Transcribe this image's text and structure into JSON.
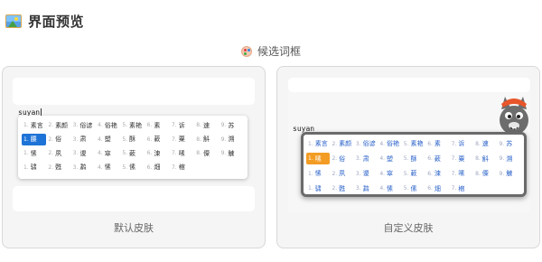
{
  "header": {
    "title": "界面预览",
    "icon": "picture-icon"
  },
  "subheader": {
    "title": "候选词框",
    "icon": "palette-icon"
  },
  "default_skin": {
    "label": "默认皮肤",
    "pinyin": "suyan",
    "accent_color": "#1e73d7",
    "rows": [
      [
        {
          "num": "1.",
          "text": "素言"
        },
        {
          "num": "2.",
          "text": "素颜"
        },
        {
          "num": "3.",
          "text": "俗谚"
        },
        {
          "num": "4.",
          "text": "俗艳"
        },
        {
          "num": "5.",
          "text": "素艳"
        },
        {
          "num": "6.",
          "text": "素"
        },
        {
          "num": "7.",
          "text": "诉"
        },
        {
          "num": "8.",
          "text": "速"
        },
        {
          "num": "9.",
          "text": "苏"
        }
      ],
      [
        {
          "num": "1.",
          "text": "腰",
          "selected": true
        },
        {
          "num": "2.",
          "text": "俗"
        },
        {
          "num": "3.",
          "text": "肃"
        },
        {
          "num": "4.",
          "text": "塑"
        },
        {
          "num": "5.",
          "text": "酥"
        },
        {
          "num": "6.",
          "text": "蔌"
        },
        {
          "num": "7.",
          "text": "粟"
        },
        {
          "num": "8.",
          "text": "斛"
        },
        {
          "num": "9.",
          "text": "溯"
        }
      ],
      [
        {
          "num": "1.",
          "text": "愫"
        },
        {
          "num": "2.",
          "text": "夙"
        },
        {
          "num": "3.",
          "text": "谡"
        },
        {
          "num": "4.",
          "text": "窣"
        },
        {
          "num": "5.",
          "text": "蔌"
        },
        {
          "num": "6.",
          "text": "涑"
        },
        {
          "num": "7.",
          "text": "嗉"
        },
        {
          "num": "8.",
          "text": "僳"
        },
        {
          "num": "9.",
          "text": "觫"
        }
      ],
      [
        {
          "num": "1.",
          "text": "骕"
        },
        {
          "num": "2.",
          "text": "甦"
        },
        {
          "num": "3.",
          "text": "鹔"
        },
        {
          "num": "4.",
          "text": "愫"
        },
        {
          "num": "5.",
          "text": "傃"
        },
        {
          "num": "6.",
          "text": "畑"
        },
        {
          "num": "7.",
          "text": "樎"
        }
      ]
    ]
  },
  "custom_skin": {
    "label": "自定义皮肤",
    "pinyin": "suyan",
    "accent_color": "#f39c24",
    "mascot": "gray-cat-mascot",
    "rows": [
      [
        {
          "num": "1.",
          "text": "素言"
        },
        {
          "num": "2.",
          "text": "素颜"
        },
        {
          "num": "3.",
          "text": "俗谚"
        },
        {
          "num": "4.",
          "text": "俗艳"
        },
        {
          "num": "5.",
          "text": "素艳"
        },
        {
          "num": "6.",
          "text": "素"
        },
        {
          "num": "7.",
          "text": "诉"
        },
        {
          "num": "8.",
          "text": "速"
        },
        {
          "num": "9.",
          "text": "苏"
        }
      ],
      [
        {
          "num": "1.",
          "text": "嗉",
          "selected": true
        },
        {
          "num": "2.",
          "text": "俗"
        },
        {
          "num": "3.",
          "text": "肃"
        },
        {
          "num": "4.",
          "text": "塑"
        },
        {
          "num": "5.",
          "text": "酥"
        },
        {
          "num": "6.",
          "text": "蔌"
        },
        {
          "num": "7.",
          "text": "粟"
        },
        {
          "num": "8.",
          "text": "斛"
        },
        {
          "num": "9.",
          "text": "溯"
        }
      ],
      [
        {
          "num": "1.",
          "text": "愫"
        },
        {
          "num": "2.",
          "text": "夙"
        },
        {
          "num": "3.",
          "text": "谡"
        },
        {
          "num": "4.",
          "text": "窣"
        },
        {
          "num": "5.",
          "text": "蔌"
        },
        {
          "num": "6.",
          "text": "涑"
        },
        {
          "num": "7.",
          "text": "嗉"
        },
        {
          "num": "8.",
          "text": "僳"
        },
        {
          "num": "9.",
          "text": "觫"
        }
      ],
      [
        {
          "num": "1.",
          "text": "骕"
        },
        {
          "num": "2.",
          "text": "甦"
        },
        {
          "num": "3.",
          "text": "鹔"
        },
        {
          "num": "4.",
          "text": "愫"
        },
        {
          "num": "5.",
          "text": "傃"
        },
        {
          "num": "6.",
          "text": "畑"
        },
        {
          "num": "7.",
          "text": "樎"
        }
      ]
    ]
  }
}
